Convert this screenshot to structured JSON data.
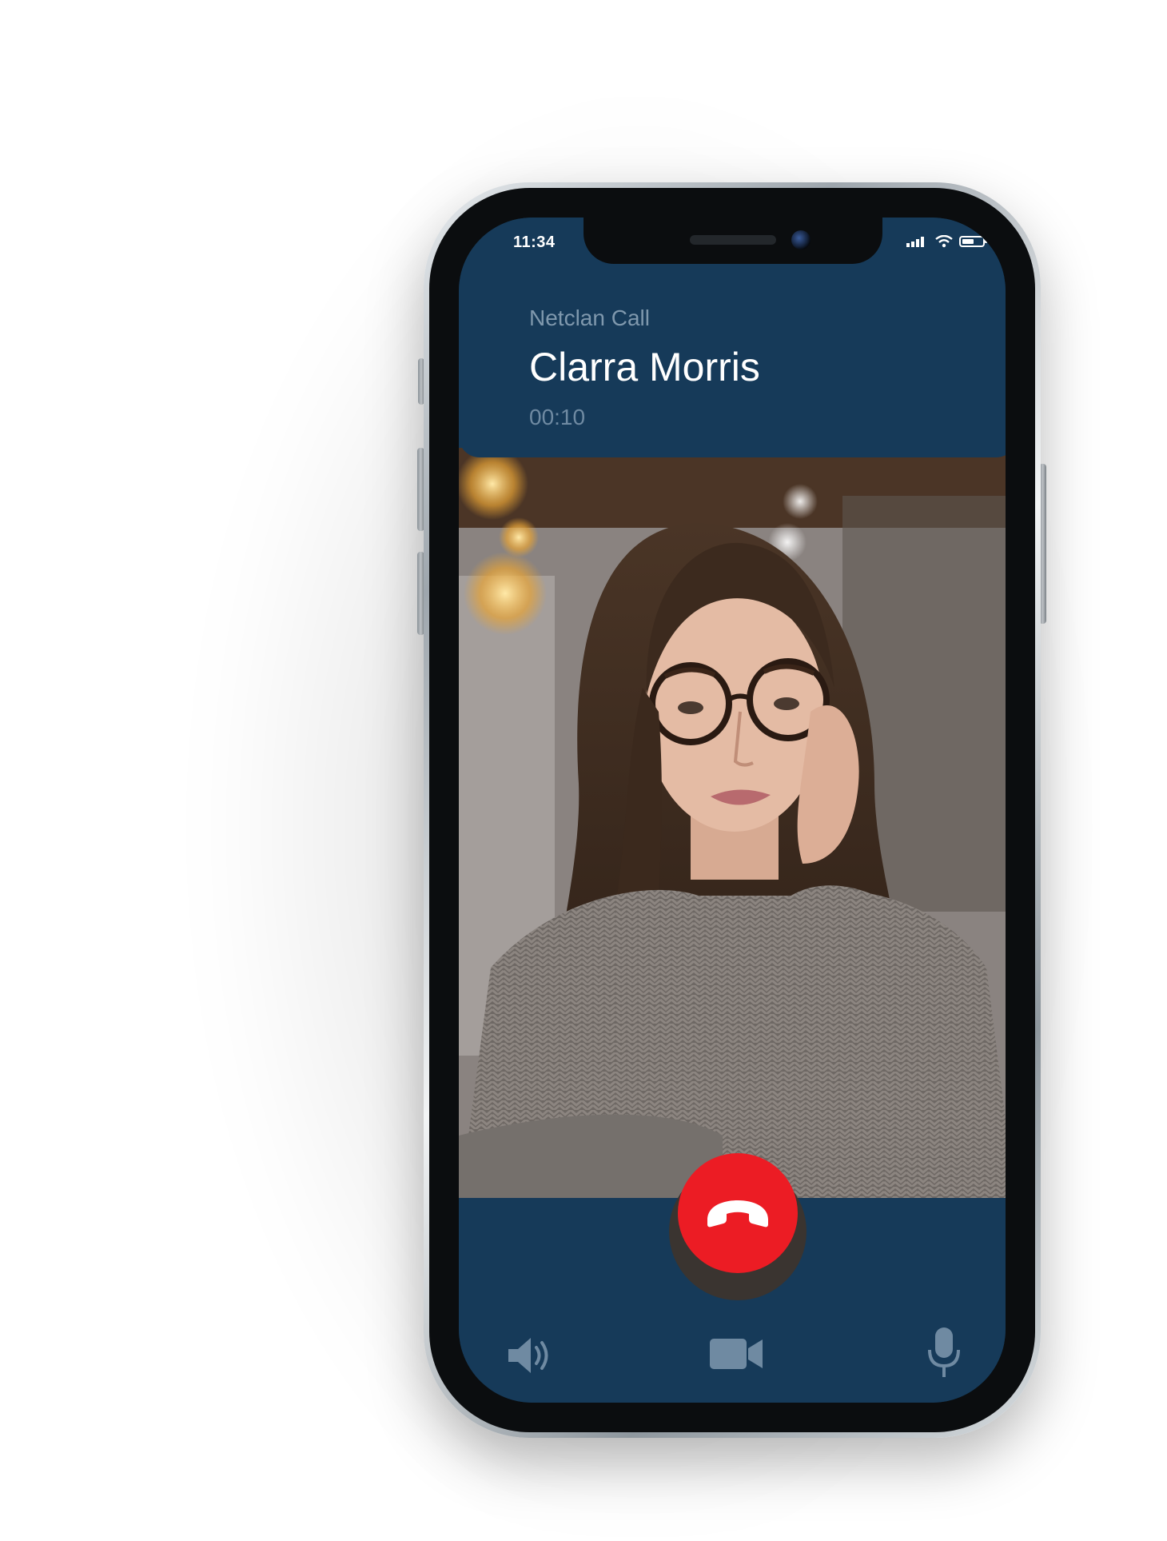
{
  "status_bar": {
    "time": "11:34"
  },
  "call": {
    "app_name": "Netclan Call",
    "caller_name": "Clarra Morris",
    "duration": "00:10"
  },
  "controls": [
    "speaker-icon",
    "video-camera-icon",
    "microphone-icon",
    "end-call-icon"
  ],
  "colors": {
    "panel": "#163a59",
    "end_call": "#ec1c24",
    "icon": "#6f8aa2"
  }
}
